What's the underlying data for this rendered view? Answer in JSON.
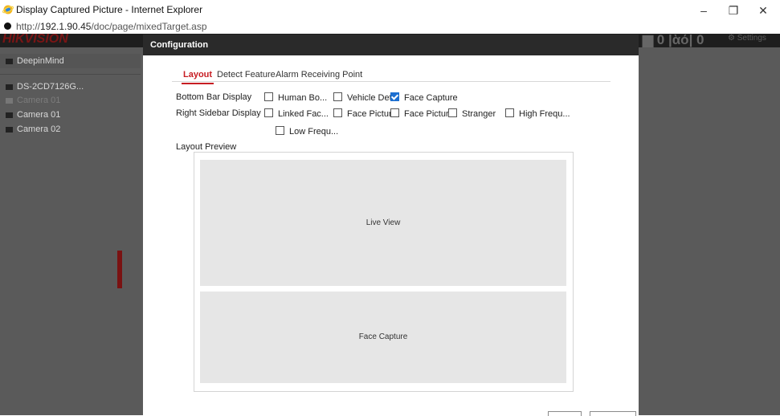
{
  "window": {
    "title": "Display Captured Picture - Internet Explorer",
    "minimize": "–",
    "restore": "❐",
    "close": "✕"
  },
  "address": {
    "url_prefix": "http://",
    "url_host": "192.1.90.45",
    "url_path": "/doc/page/mixedTarget.asp"
  },
  "app": {
    "brand": "HIKVISION",
    "sidebar": {
      "group": "DeepinMind",
      "items": [
        "DS-2CD7126G...",
        "Camera 01",
        "Camera 01",
        "Camera 02"
      ]
    },
    "counters": "▆ 0  |ὰό| 0",
    "settings": "⚙ Settings"
  },
  "dialog": {
    "title": "Configuration",
    "tabs": [
      "Layout",
      "Detect Feature",
      "Alarm Receiving Point"
    ],
    "active_tab": "Layout",
    "bottom_bar": {
      "label": "Bottom Bar Display",
      "options": [
        {
          "label": "Human Bo...",
          "checked": false
        },
        {
          "label": "Vehicle Det...",
          "checked": false
        },
        {
          "label": "Face Capture",
          "checked": true
        }
      ]
    },
    "right_sidebar": {
      "label": "Right Sidebar Display",
      "options": [
        {
          "label": "Linked Fac...",
          "checked": false
        },
        {
          "label": "Face Pictur...",
          "checked": false
        },
        {
          "label": "Face Pictur...",
          "checked": false
        },
        {
          "label": "Stranger",
          "checked": false
        },
        {
          "label": "High Frequ...",
          "checked": false
        },
        {
          "label": "Low Frequ...",
          "checked": false
        }
      ]
    },
    "layout_preview_label": "Layout Preview",
    "preview_panes": [
      "Live View",
      "Face Capture"
    ]
  },
  "colors": {
    "accent": "#c71d23",
    "checkbox_checked": "#1c6fd1",
    "dialog_header": "#2a2a2a",
    "overlay": "#5b5b5b",
    "pane": "#e6e6e6"
  }
}
